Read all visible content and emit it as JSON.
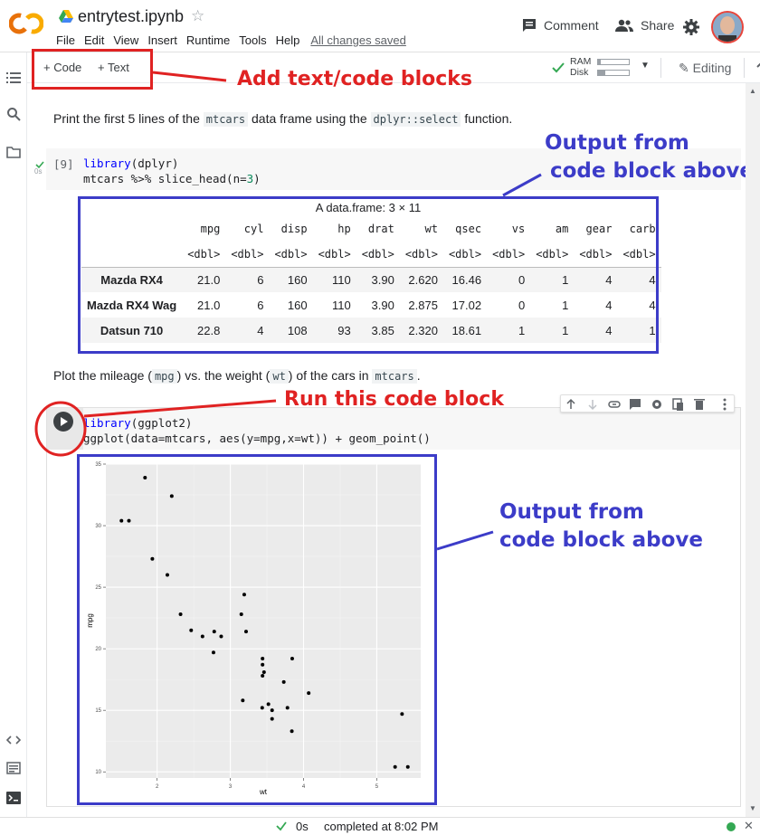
{
  "header": {
    "title": "entrytest.ipynb",
    "menu": [
      "File",
      "Edit",
      "View",
      "Insert",
      "Runtime",
      "Tools",
      "Help"
    ],
    "saved_status": "All changes saved",
    "comment_label": "Comment",
    "share_label": "Share",
    "icons": [
      "colab-logo-icon",
      "drive-icon",
      "star-icon",
      "comment-icon",
      "share-icon",
      "gear-icon",
      "avatar"
    ]
  },
  "toolbar": {
    "add_code": "+ Code",
    "add_text": "+ Text",
    "ram_label": "RAM",
    "disk_label": "Disk",
    "editing_label": "Editing"
  },
  "cells": {
    "text1": {
      "before": "Print the first 5 lines of the ",
      "code1": "mtcars",
      "middle": " data frame using the ",
      "code2": "dplyr::select",
      "after": " function."
    },
    "code1": {
      "exec_count": "[9]",
      "exec_time": "0s",
      "line1_kw": "library",
      "line1_rest": "(dplyr)",
      "line2_a": "mtcars %>% slice_head(n=",
      "line2_num": "3",
      "line2_b": ")"
    },
    "df": {
      "caption": "A data.frame: 3 × 11",
      "columns": [
        "mpg",
        "cyl",
        "disp",
        "hp",
        "drat",
        "wt",
        "qsec",
        "vs",
        "am",
        "gear",
        "carb"
      ],
      "types": [
        "<dbl>",
        "<dbl>",
        "<dbl>",
        "<dbl>",
        "<dbl>",
        "<dbl>",
        "<dbl>",
        "<dbl>",
        "<dbl>",
        "<dbl>",
        "<dbl>"
      ],
      "rows": [
        {
          "name": "Mazda RX4",
          "values": [
            "21.0",
            "6",
            "160",
            "110",
            "3.90",
            "2.620",
            "16.46",
            "0",
            "1",
            "4",
            "4"
          ]
        },
        {
          "name": "Mazda RX4 Wag",
          "values": [
            "21.0",
            "6",
            "160",
            "110",
            "3.90",
            "2.875",
            "17.02",
            "0",
            "1",
            "4",
            "4"
          ]
        },
        {
          "name": "Datsun 710",
          "values": [
            "22.8",
            "4",
            "108",
            "93",
            "3.85",
            "2.320",
            "18.61",
            "1",
            "1",
            "4",
            "1"
          ]
        }
      ]
    },
    "text2": {
      "before": "Plot the mileage (",
      "code1": "mpg",
      "middle1": ") vs. the weight (",
      "code2": "wt",
      "middle2": ") of the cars in ",
      "code3": "mtcars",
      "after": "."
    },
    "code2": {
      "line1_kw": "library",
      "line1_rest": "(ggplot2)",
      "line2": "ggplot(data=mtcars, aes(y=mpg,x=wt)) + geom_point()"
    },
    "cell_toolbar_icons": [
      "arrow-up-icon",
      "arrow-down-icon",
      "link-icon",
      "comment-icon",
      "gear-icon",
      "mirror-icon",
      "delete-icon",
      "more-icon"
    ]
  },
  "chart_data": {
    "type": "scatter",
    "xlabel": "wt",
    "ylabel": "mpg",
    "xlim": [
      1.3,
      5.6
    ],
    "ylim": [
      9.5,
      35.0
    ],
    "xticks": [
      2,
      3,
      4,
      5
    ],
    "yticks": [
      10,
      15,
      20,
      25,
      30,
      35
    ],
    "grid": true,
    "x": [
      2.62,
      2.875,
      2.32,
      3.215,
      3.44,
      3.46,
      3.57,
      3.19,
      3.15,
      3.44,
      3.44,
      4.07,
      3.73,
      3.78,
      5.25,
      5.424,
      5.345,
      2.2,
      1.615,
      1.835,
      2.465,
      3.52,
      3.435,
      3.84,
      3.845,
      1.935,
      2.14,
      1.513,
      3.17,
      2.77,
      3.57,
      2.78
    ],
    "y": [
      21.0,
      21.0,
      22.8,
      21.4,
      18.7,
      18.1,
      14.3,
      24.4,
      22.8,
      19.2,
      17.8,
      16.4,
      17.3,
      15.2,
      10.4,
      10.4,
      14.7,
      32.4,
      30.4,
      33.9,
      21.5,
      15.5,
      15.2,
      13.3,
      19.2,
      27.3,
      26.0,
      30.4,
      15.8,
      19.7,
      15.0,
      21.4
    ]
  },
  "annotations": {
    "add_blocks": "Add text/code blocks",
    "output_above_1_line1": "Output from",
    "output_above_1_line2": "code block above",
    "run_block": "Run this code block",
    "output_above_2_line1": "Output from",
    "output_above_2_line2": "code block above"
  },
  "status": {
    "time": "0s",
    "completed": "completed at 8:02 PM"
  },
  "colors": {
    "annotation_blue": "#3c3cc8",
    "annotation_red": "#e02222",
    "colab_orange": "#f9ab00",
    "check_green": "#34a853"
  }
}
